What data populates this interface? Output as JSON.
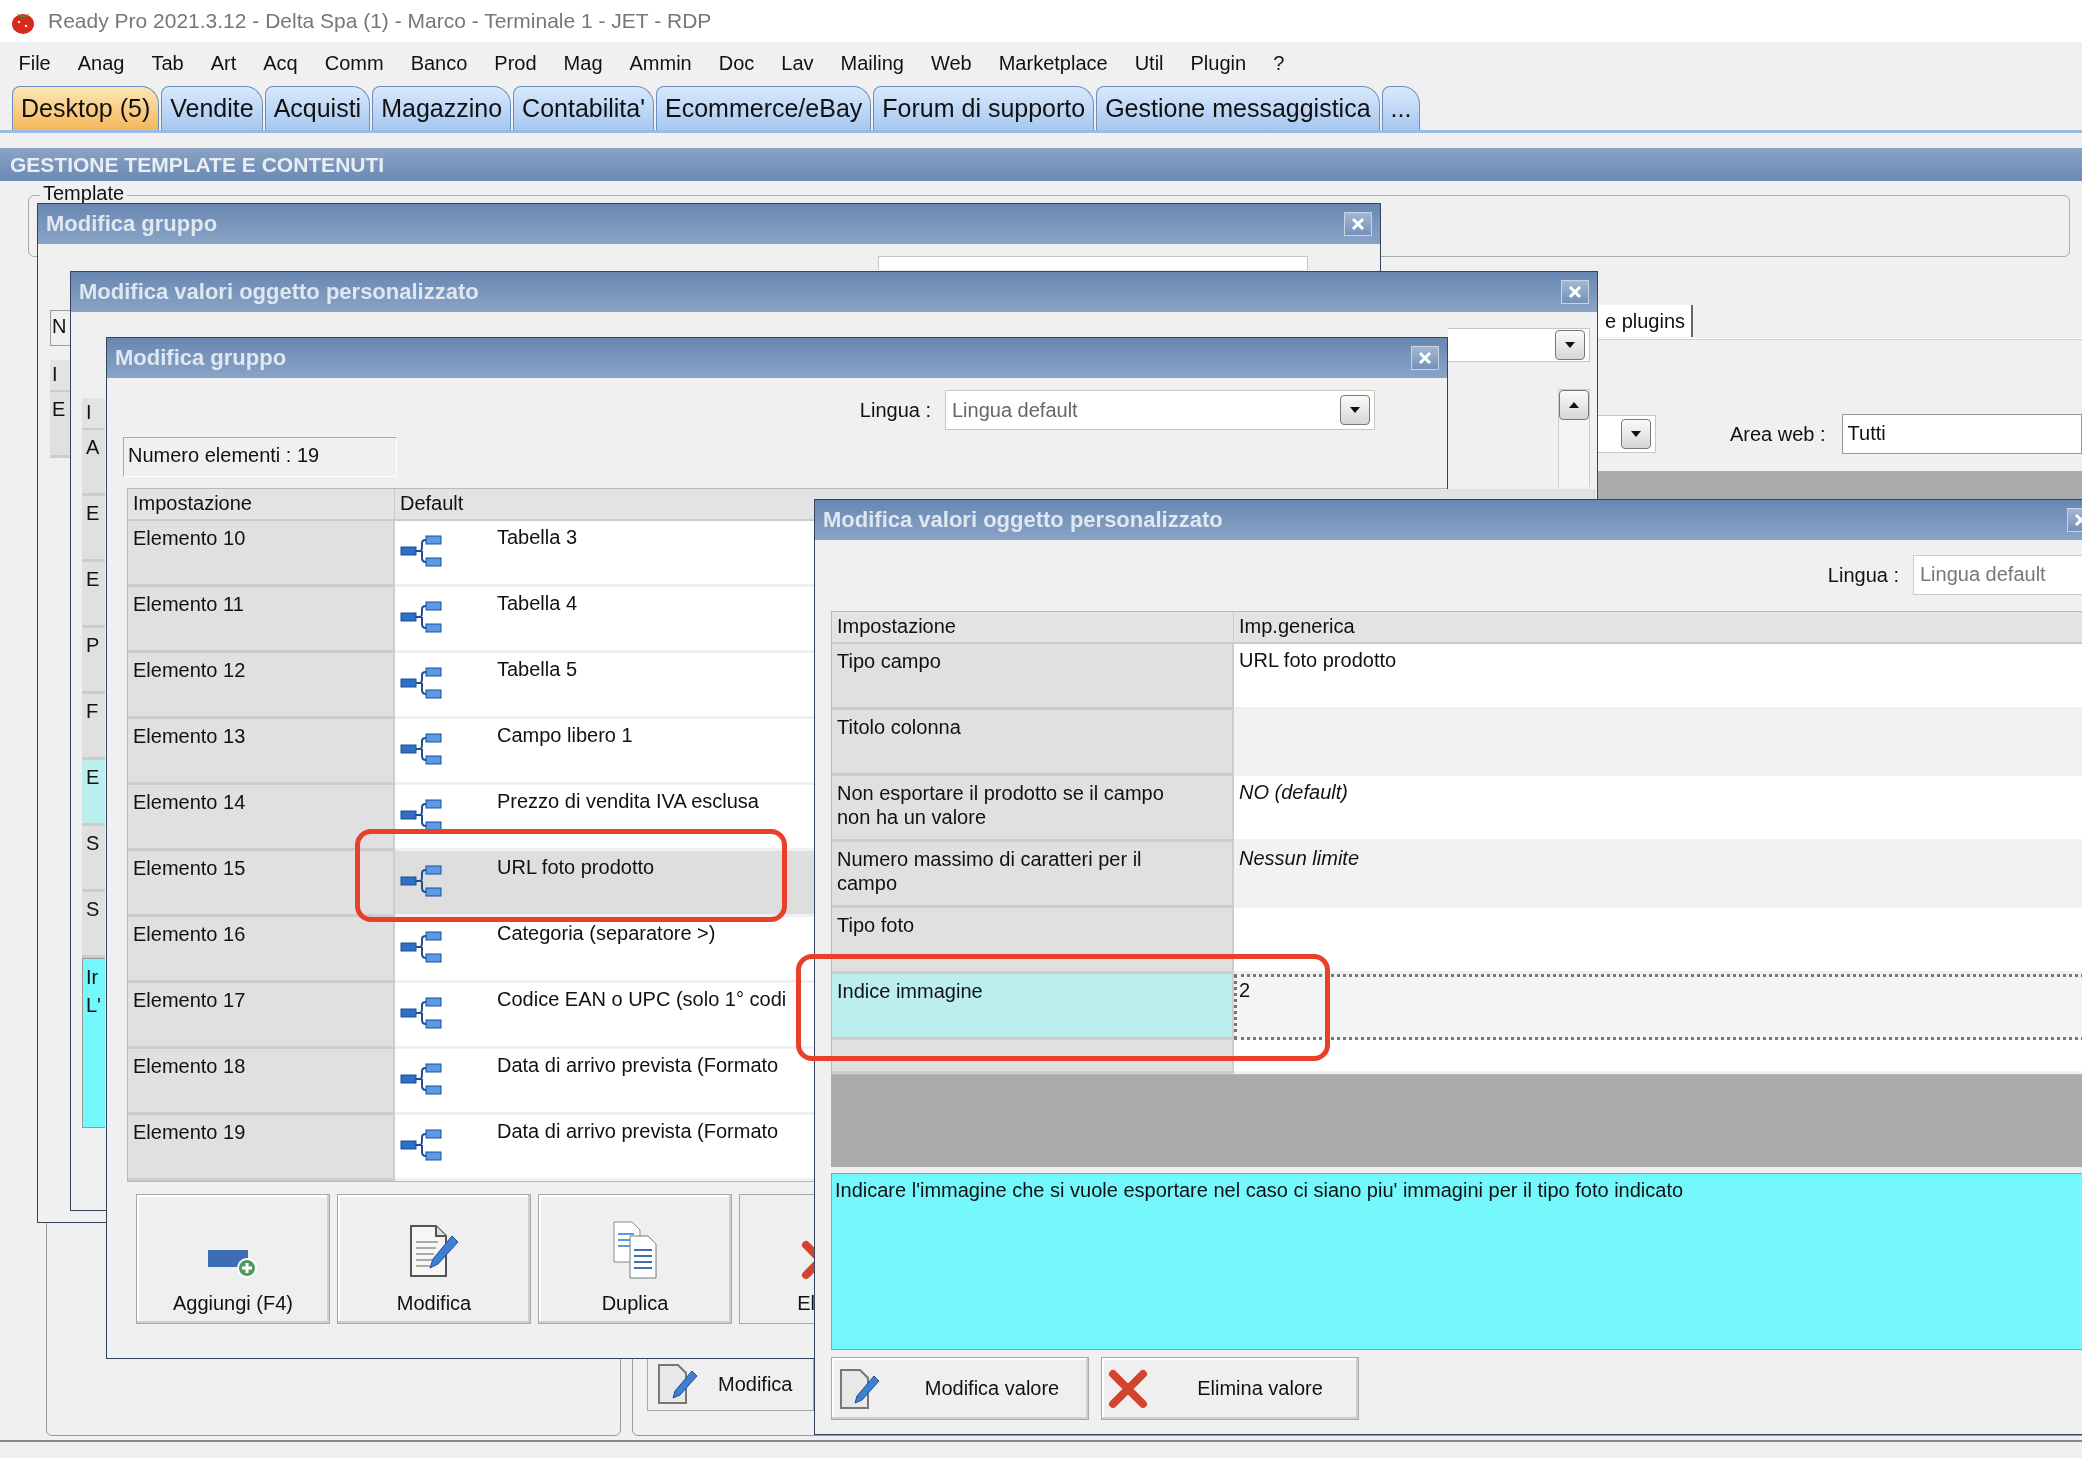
{
  "window": {
    "title": "Ready Pro 2021.3.12 - Delta Spa (1) - Marco - Terminale 1 - JET - RDP"
  },
  "menu": [
    "File",
    "Anag",
    "Tab",
    "Art",
    "Acq",
    "Comm",
    "Banco",
    "Prod",
    "Mag",
    "Ammin",
    "Doc",
    "Lav",
    "Mailing",
    "Web",
    "Marketplace",
    "Util",
    "Plugin",
    "?"
  ],
  "tabs": [
    {
      "label": "Desktop (5)",
      "selected": true
    },
    {
      "label": "Vendite",
      "selected": false
    },
    {
      "label": "Acquisti",
      "selected": false
    },
    {
      "label": "Magazzino",
      "selected": false
    },
    {
      "label": "Contabilita'",
      "selected": false
    },
    {
      "label": "Ecommerce/eBay",
      "selected": false
    },
    {
      "label": "Forum di supporto",
      "selected": false
    },
    {
      "label": "Gestione messaggistica",
      "selected": false
    },
    {
      "label": "...",
      "selected": false
    }
  ],
  "section_title": "GESTIONE TEMPLATE E CONTENUTI",
  "background": {
    "group_label": "Template",
    "tab_fragment": "e plugins",
    "area_web": {
      "label": "Area web :",
      "value": "Tutti"
    },
    "button": "Modifica"
  },
  "dialogs": [
    {
      "kind": "group_back",
      "title": "Modifica gruppo",
      "field_fragment": "N",
      "header_fragment": "I",
      "row_fragments": [
        "E"
      ]
    },
    {
      "kind": "values_back",
      "title": "Modifica valori oggetto personalizzato",
      "header_fragment": "I",
      "row_fragments": [
        {
          "text": "A",
          "selected": false
        },
        {
          "text": "E",
          "selected": false
        },
        {
          "text": "E",
          "selected": false
        },
        {
          "text": "P",
          "selected": false
        },
        {
          "text": "F",
          "selected": false
        },
        {
          "text": "E",
          "selected": true
        },
        {
          "text": "S",
          "selected": false
        },
        {
          "text": "S",
          "selected": false
        }
      ],
      "description_lines": [
        "Ir",
        "L'"
      ]
    },
    {
      "kind": "group",
      "title": "Modifica gruppo",
      "language": {
        "label": "Lingua :",
        "value": "Lingua default"
      },
      "count": "Numero elementi : 19",
      "columns": [
        "Impostazione",
        "Default"
      ],
      "rows": [
        {
          "name": "Elemento 10",
          "value": "Tabella 3",
          "selected": false,
          "highlighted": false
        },
        {
          "name": "Elemento 11",
          "value": "Tabella 4",
          "selected": false,
          "highlighted": false
        },
        {
          "name": "Elemento 12",
          "value": "Tabella 5",
          "selected": false,
          "highlighted": false
        },
        {
          "name": "Elemento 13",
          "value": "Campo libero 1",
          "selected": false,
          "highlighted": false
        },
        {
          "name": "Elemento 14",
          "value": "Prezzo di vendita IVA esclusa",
          "selected": false,
          "highlighted": false
        },
        {
          "name": "Elemento 15",
          "value": "URL foto prodotto",
          "selected": true,
          "highlighted": true
        },
        {
          "name": "Elemento 16",
          "value": "Categoria (separatore >)",
          "selected": false,
          "highlighted": false
        },
        {
          "name": "Elemento 17",
          "value": "Codice EAN o UPC (solo 1° codi",
          "selected": false,
          "highlighted": false
        },
        {
          "name": "Elemento 18",
          "value": "Data di arrivo prevista (Formato",
          "selected": false,
          "highlighted": false
        },
        {
          "name": "Elemento 19",
          "value": "Data di arrivo prevista (Formato",
          "selected": false,
          "highlighted": false
        }
      ],
      "buttons": [
        {
          "label": "Aggiungi (F4)",
          "kind": "add"
        },
        {
          "label": "Modifica",
          "kind": "edit"
        },
        {
          "label": "Duplica",
          "kind": "duplicate"
        },
        {
          "label": "El",
          "kind": "delete"
        }
      ]
    },
    {
      "kind": "values",
      "title": "Modifica valori oggetto personalizzato",
      "language": {
        "label": "Lingua :",
        "value": "Lingua default"
      },
      "columns": [
        "Impostazione",
        "Imp.generica"
      ],
      "rows": [
        {
          "name": "Tipo campo",
          "value": "URL foto prodotto",
          "italic": false,
          "selected": false,
          "highlighted": false
        },
        {
          "name": "Titolo colonna",
          "selected": false,
          "highlighted": false
        },
        {
          "name": "Non esportare il prodotto se il campo non ha un valore",
          "value": "NO (default)",
          "italic": true,
          "selected": false,
          "highlighted": false
        },
        {
          "name": "Numero massimo di caratteri per il campo",
          "value": "Nessun limite",
          "italic": true,
          "selected": false,
          "highlighted": false
        },
        {
          "name": "Tipo foto",
          "selected": false,
          "highlighted": false
        },
        {
          "name": "Indice immagine",
          "value": "2",
          "italic": false,
          "selected": true,
          "highlighted": true
        }
      ],
      "description": "Indicare l'immagine che si vuole esportare nel caso ci siano piu' immagini per il tipo foto indicato",
      "buttons": [
        {
          "label": "Modifica valore",
          "kind": "edit"
        },
        {
          "label": "Elimina valore",
          "kind": "delete"
        }
      ]
    }
  ]
}
